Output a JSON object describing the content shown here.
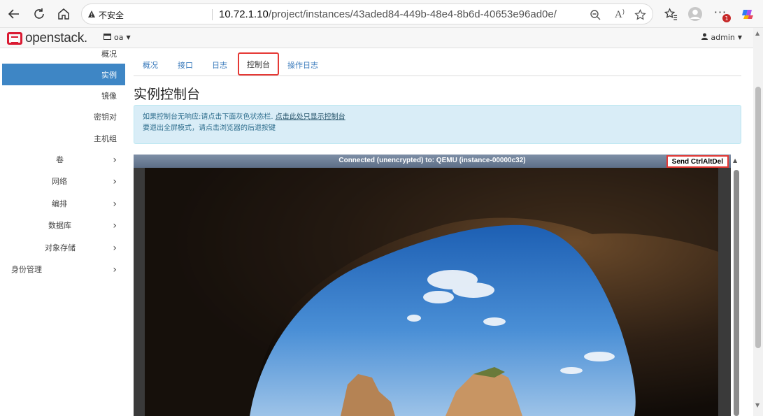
{
  "browser": {
    "security_label": "不安全",
    "url_host": "10.72.1.10",
    "url_path": "/project/instances/43aded84-449b-48e4-8b6d-40653e96ad0e/",
    "notification_count": "1"
  },
  "header": {
    "logo_text": "openstack.",
    "project": "oa",
    "user": "admin"
  },
  "sidebar": {
    "items": [
      {
        "label": "概况"
      },
      {
        "label": "实例"
      },
      {
        "label": "镜像"
      },
      {
        "label": "密钥对"
      },
      {
        "label": "主机组"
      }
    ],
    "groups": [
      {
        "label": "卷"
      },
      {
        "label": "网络"
      },
      {
        "label": "编排"
      },
      {
        "label": "数据库"
      },
      {
        "label": "对象存储"
      },
      {
        "label": "身份管理"
      }
    ]
  },
  "tabs": [
    {
      "label": "概况"
    },
    {
      "label": "接口"
    },
    {
      "label": "日志"
    },
    {
      "label": "控制台"
    },
    {
      "label": "操作日志"
    }
  ],
  "page_title": "实例控制台",
  "alert": {
    "line1_text": "如果控制台无响应:请点击下面灰色状态栏.",
    "line1_link": "点击此处只显示控制台",
    "line2_text": "要退出全屏模式，请点击浏览器的后退按键"
  },
  "console": {
    "status": "Connected (unencrypted) to: QEMU (instance-00000c32)",
    "ctrl_alt_del": "Send CtrlAltDel"
  },
  "colors": {
    "accent": "#3e86c5",
    "highlight_border": "#e53935",
    "alert_bg": "#d9edf7"
  }
}
